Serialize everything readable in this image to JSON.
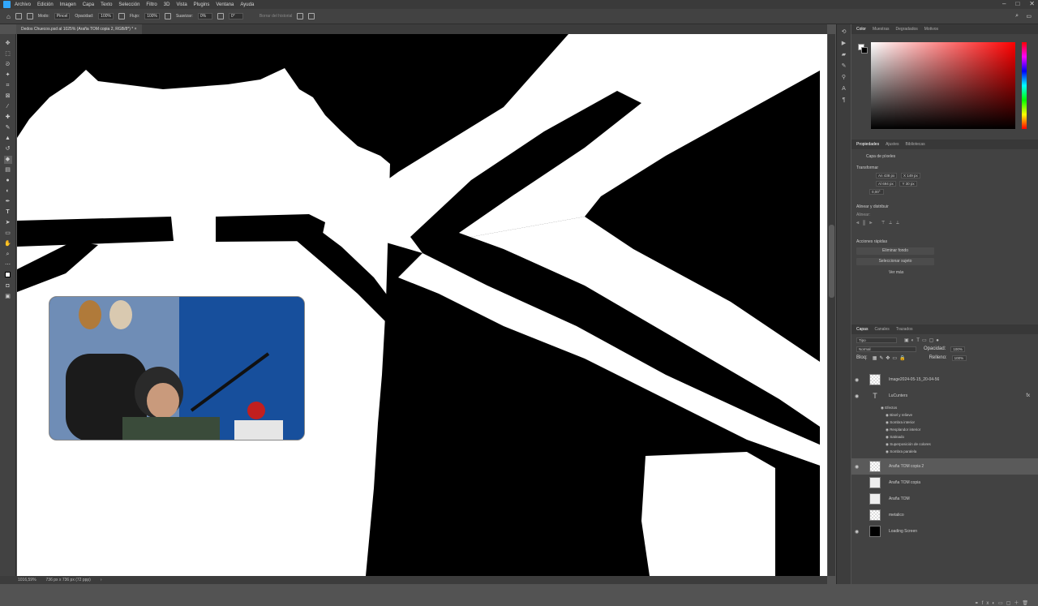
{
  "menu": [
    "Archivo",
    "Edición",
    "Imagen",
    "Capa",
    "Texto",
    "Selección",
    "Filtro",
    "3D",
    "Vista",
    "Plugins",
    "Ventana",
    "Ayuda"
  ],
  "options": {
    "mode_label": "Modo:",
    "mode_value": "Pincel",
    "opacity_label": "Opacidad:",
    "opacity_value": "100%",
    "flow_label": "Flujo:",
    "flow_value": "100%",
    "smooth_label": "Suavizar:",
    "smooth_value": "0%",
    "angle_value": "0°",
    "history_label": "Borrar del historial"
  },
  "document_tab": "Dedos Chuecos.psd al 1025% (Araña TOM copia 2, RGB/8*) *",
  "status": {
    "zoom": "1016,59%",
    "size": "736 px x 736 px (72 ppp)"
  },
  "panels": {
    "color_tabs": [
      "Color",
      "Muestras",
      "Degradados",
      "Motivos"
    ],
    "props_tabs": [
      "Propiedades",
      "Ajustes",
      "Bibliotecas"
    ],
    "props_kind": "Capa de píxeles",
    "transform_title": "Transformar",
    "w_label": "An",
    "w_value": "438 px",
    "x_label": "X",
    "x_value": "149 px",
    "h_label": "Al",
    "h_value": "694 px",
    "y_label": "Y",
    "y_value": "30 px",
    "angle_value": "0,00°",
    "align_title": "Alinear y distribuir",
    "align_sub": "Alinear:",
    "quick_title": "Acciones rápidas",
    "quick_btn1": "Eliminar fondo",
    "quick_btn2": "Seleccionar sujeto",
    "quick_more": "Ver más",
    "layers_tabs": [
      "Capas",
      "Canales",
      "Trazados"
    ],
    "filter_kind": "Tipo",
    "blend": "Normal",
    "opacity_label": "Opacidad:",
    "opacity_value": "100%",
    "lock_label": "Bloq:",
    "fill_label": "Relleno:",
    "fill_value": "100%"
  },
  "layers": [
    {
      "name": "Image2024-05-15_20-04-56",
      "visible": true,
      "sel": false
    },
    {
      "name": "LuCunters",
      "visible": true,
      "sel": false,
      "type": "text"
    },
    {
      "name": "Araña TOM copia 2",
      "visible": true,
      "sel": true
    },
    {
      "name": "Araña TOM copia",
      "visible": false,
      "sel": false
    },
    {
      "name": "Araña TOM",
      "visible": false,
      "sel": false
    },
    {
      "name": "metalico",
      "visible": false,
      "sel": false
    },
    {
      "name": "Loading Screen",
      "visible": true,
      "sel": false,
      "dark": true
    }
  ],
  "effects_title": "Efectos",
  "effects": [
    "Bisel y relieve",
    "Sombra interior",
    "Resplandor interior",
    "Satinado",
    "Superposición de colores",
    "Sombra paralela"
  ]
}
